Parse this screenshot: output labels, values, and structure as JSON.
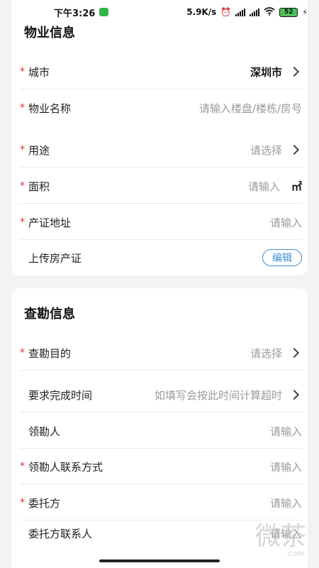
{
  "status_bar": {
    "time": "下午3:26",
    "net_speed": "5.9K/s",
    "battery": "52"
  },
  "property_section": {
    "title": "物业信息",
    "rows": [
      {
        "label": "城市",
        "value": "深圳市"
      },
      {
        "label": "物业名称",
        "placeholder": "请输入楼盘/楼栋/房号"
      },
      {
        "label": "用途",
        "placeholder": "请选择"
      },
      {
        "label": "面积",
        "placeholder": "请输入",
        "unit": "㎡"
      },
      {
        "label": "产证地址",
        "placeholder": "请输入"
      },
      {
        "label": "上传房产证",
        "button": "编辑"
      }
    ]
  },
  "survey_section": {
    "title": "查勘信息",
    "rows": [
      {
        "label": "查勘目的",
        "placeholder": "请选择"
      },
      {
        "label": "要求完成时间",
        "placeholder": "如填写会按此时间计算超时"
      },
      {
        "label": "领勘人",
        "placeholder": "请输入"
      },
      {
        "label": "领勘人联系方式",
        "placeholder": "请输入"
      },
      {
        "label": "委托方",
        "placeholder": "请输入"
      },
      {
        "label": "委托方联系人",
        "placeholder": "请输入"
      }
    ]
  },
  "watermark": {
    "text": "微茶",
    "sub": ".com"
  }
}
